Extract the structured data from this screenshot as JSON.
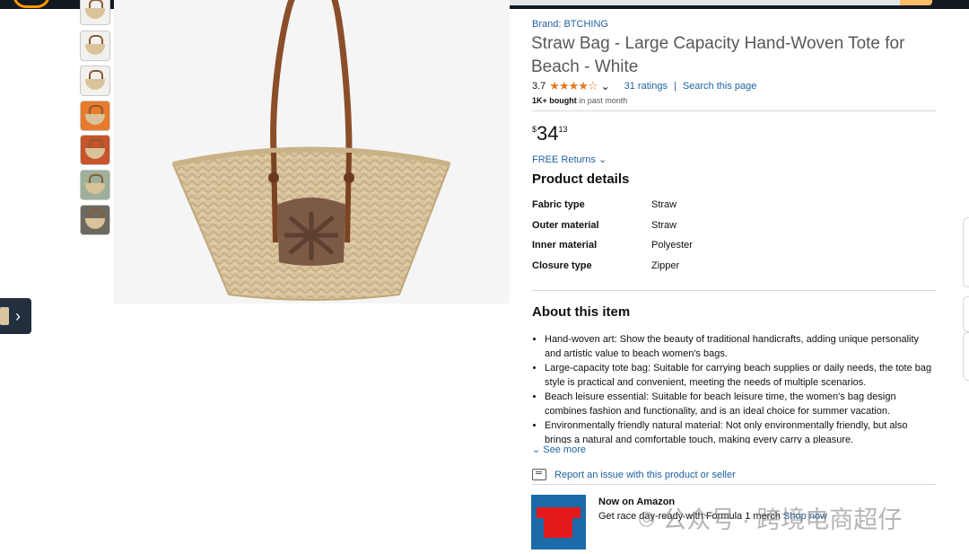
{
  "product": {
    "brand": "Brand: BTCHING",
    "title": "Straw Bag - Large Capacity Hand-Woven Tote for Beach - White",
    "rating_value": "3.7",
    "stars": "★★★★☆",
    "ratings_link": "31 ratings",
    "rating_separator": "|",
    "search_page_link": "Search this page",
    "bought_bold": "1K+ bought",
    "bought_rest": " in past month",
    "price_symbol": "$",
    "price_whole": "34",
    "price_fraction": "13",
    "returns": "FREE Returns",
    "returns_chevron": "⌄"
  },
  "details": {
    "heading": "Product details",
    "rows": [
      {
        "key": "Fabric type",
        "value": "Straw"
      },
      {
        "key": "Outer material",
        "value": "Straw"
      },
      {
        "key": "Inner material",
        "value": "Polyester"
      },
      {
        "key": "Closure type",
        "value": "Zipper"
      }
    ]
  },
  "about": {
    "heading": "About this item",
    "bullets": [
      "Hand-woven art: Show the beauty of traditional handicrafts, adding unique personality and artistic value to beach women's bags.",
      "Large-capacity tote bag: Suitable for carrying beach supplies or daily needs, the tote bag style is practical and convenient, meeting the needs of multiple scenarios.",
      "Beach leisure essential: Suitable for beach leisure time, the women's bag design combines fashion and functionality, and is an ideal choice for summer vacation.",
      "Environmentally friendly natural material: Not only environmentally friendly, but also brings a natural and comfortable touch, making every carry a pleasure."
    ],
    "see_more": "See more",
    "see_more_chevron": "⌄"
  },
  "report": {
    "label": "Report an issue with this product or seller",
    "icon": "report-flag-icon"
  },
  "promo": {
    "title": "Now on Amazon",
    "text": "Get race day-ready with Formula 1 merch",
    "link": "Shop now"
  },
  "gallery": {
    "thumbnail_count": 7,
    "next_arrow": "›"
  },
  "watermark": {
    "text": "公众号 · 跨境电商超仔",
    "icon": "wechat-icon"
  },
  "colors": {
    "link": "#2162a1",
    "star": "#de7921",
    "nav": "#131921",
    "accent": "#ff9900"
  }
}
